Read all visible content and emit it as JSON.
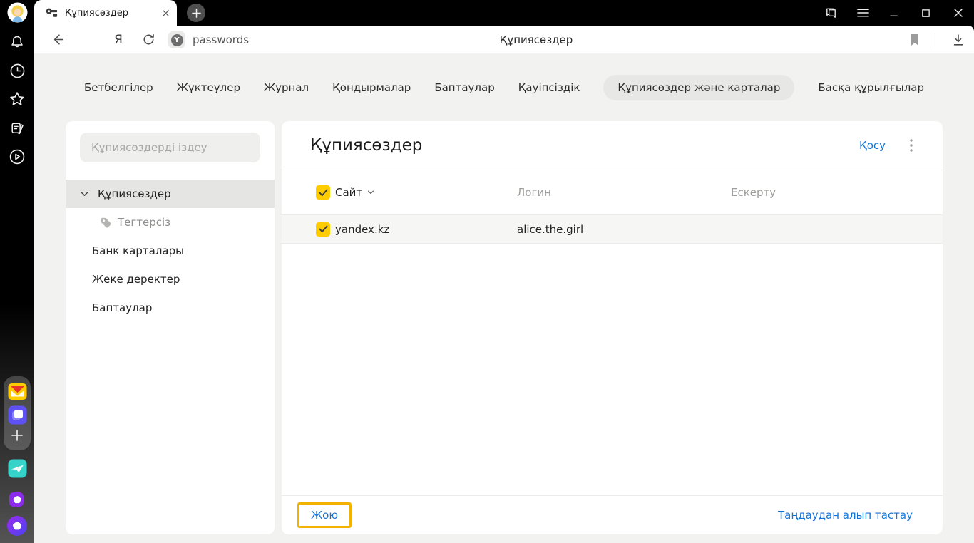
{
  "browser": {
    "tab": {
      "title": "Құпиясөздер"
    },
    "toolbar": {
      "yandex_letter": "Я",
      "badge_letter": "Y",
      "url_badge_label": "passwords",
      "page_title": "Құпиясөздер"
    }
  },
  "nav": {
    "items": [
      "Бетбелгілер",
      "Жүктеулер",
      "Журнал",
      "Қондырмалар",
      "Баптаулар",
      "Қауіпсіздік",
      "Құпиясөздер және карталар",
      "Басқа құрылғылар"
    ],
    "selected": "Құпиясөздер және карталар"
  },
  "sidebar": {
    "search_placeholder": "Құпиясөздерді іздеу",
    "items": [
      {
        "label": "Құпиясөздер",
        "selected": true
      },
      {
        "label": "Тегтерсіз"
      },
      {
        "label": "Банк карталары"
      },
      {
        "label": "Жеке деректер"
      },
      {
        "label": "Баптаулар"
      }
    ]
  },
  "main": {
    "title": "Құпиясөздер",
    "add_label": "Қосу",
    "table": {
      "headers": [
        "Сайт",
        "Логин",
        "Ескерту"
      ],
      "rows": [
        {
          "site": "yandex.kz",
          "login": "alice.the.girl",
          "note": ""
        }
      ]
    },
    "footer": {
      "delete_label": "Жою",
      "deselect_label": "Таңдаудан алып тастау"
    }
  },
  "colors": {
    "accent_yellow": "#ffcc00",
    "focus_outline": "#f2b200",
    "link_blue": "#1673d6"
  }
}
